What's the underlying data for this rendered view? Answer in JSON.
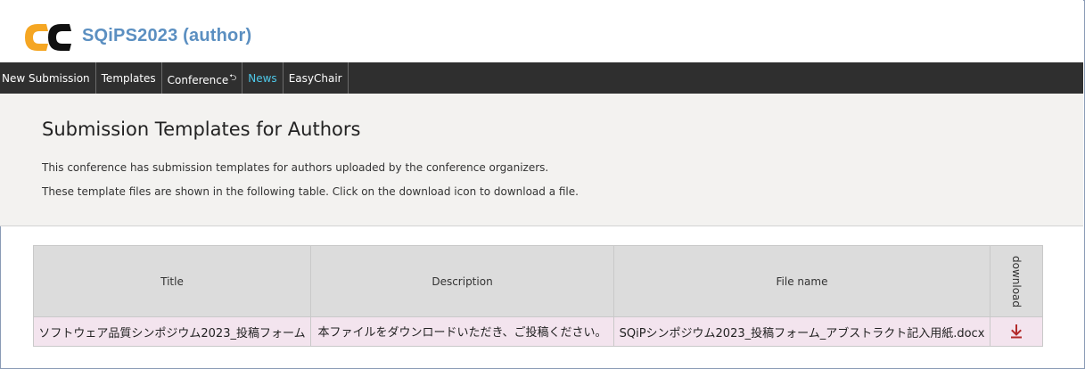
{
  "header": {
    "logo_icon": "easychair-logo-icon",
    "app_title": "SQiPS2023 (author)"
  },
  "nav": {
    "items": [
      {
        "label": "New Submission"
      },
      {
        "label": "Templates"
      },
      {
        "label": "Conference",
        "suffix": "⮌"
      },
      {
        "label": "News"
      },
      {
        "label": "EasyChair"
      }
    ],
    "active_color": "#4ec8e8"
  },
  "panel": {
    "title": "Submission Templates for Authors",
    "line1": "This conference has submission templates for authors uploaded by the conference organizers.",
    "line2": "These template files are shown in the following table. Click on the download icon to download a file."
  },
  "table": {
    "columns": [
      "Title",
      "Description",
      "File name",
      "download"
    ],
    "rows": [
      {
        "title": "ソフトウェア品質シンポジウム2023_投稿フォーム",
        "description": "本ファイルをダウンロードいただき、ご投稿ください。",
        "file_name": "SQiPシンポジウム2023_投稿フォーム_アブストラクト記入用紙.docx",
        "download_icon": "download-arrow-icon"
      }
    ]
  },
  "colors": {
    "brand_blue": "#5b8fc1",
    "nav_bg": "#2f2f2f",
    "header_row_bg": "#dcdcdc",
    "data_row_bg": "#f3e4ee",
    "download_icon": "#b22a2a"
  }
}
